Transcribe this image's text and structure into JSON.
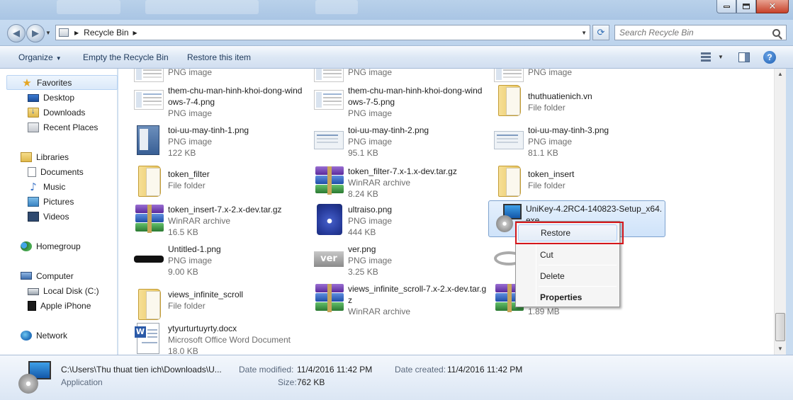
{
  "window": {
    "minimize_glyph": "",
    "close_glyph": "✕"
  },
  "address": {
    "location": "Recycle Bin",
    "search_placeholder": "Search Recycle Bin"
  },
  "toolbar": {
    "organize": "Organize",
    "empty": "Empty the Recycle Bin",
    "restore": "Restore this item",
    "help": "?"
  },
  "nav": {
    "favorites": "Favorites",
    "desktop": "Desktop",
    "downloads": "Downloads",
    "recent": "Recent Places",
    "libraries": "Libraries",
    "documents": "Documents",
    "music": "Music",
    "pictures": "Pictures",
    "videos": "Videos",
    "homegroup": "Homegroup",
    "computer": "Computer",
    "localdisk": "Local Disk (C:)",
    "iphone": "Apple iPhone",
    "network": "Network"
  },
  "files": {
    "row0": [
      {
        "type": "PNG image"
      },
      {
        "type": "PNG image"
      },
      {
        "type": "PNG image"
      }
    ],
    "f1": {
      "name": "them-chu-man-hinh-khoi-dong-windows-7-4.png",
      "type": "PNG image"
    },
    "f2": {
      "name": "them-chu-man-hinh-khoi-dong-windows-7-5.png",
      "type": "PNG image"
    },
    "f3": {
      "name": "thuthuatienich.vn",
      "type": "File folder"
    },
    "f4": {
      "name": "toi-uu-may-tinh-1.png",
      "type": "PNG image",
      "size": "122 KB"
    },
    "f5": {
      "name": "toi-uu-may-tinh-2.png",
      "type": "PNG image",
      "size": "95.1 KB"
    },
    "f6": {
      "name": "toi-uu-may-tinh-3.png",
      "type": "PNG image",
      "size": "81.1 KB"
    },
    "f7": {
      "name": "token_filter",
      "type": "File folder"
    },
    "f8": {
      "name": "token_filter-7.x-1.x-dev.tar.gz",
      "type": "WinRAR archive",
      "size": "8.24 KB"
    },
    "f9": {
      "name": "token_insert",
      "type": "File folder"
    },
    "f10": {
      "name": "token_insert-7.x-2.x-dev.tar.gz",
      "type": "WinRAR archive",
      "size": "16.5 KB"
    },
    "f11": {
      "name": "ultraiso.png",
      "type": "PNG image",
      "size": "444 KB"
    },
    "f12": {
      "name": "UniKey-4.2RC4-140823-Setup_x64.exe"
    },
    "f13": {
      "name": "Untitled-1.png",
      "type": "PNG image",
      "size": "9.00 KB"
    },
    "f14": {
      "name": "ver.png",
      "type": "PNG image",
      "size": "3.25 KB"
    },
    "f16": {
      "name": "views_infinite_scroll",
      "type": "File folder"
    },
    "f17": {
      "name": "views_infinite_scroll-7.x-2.x-dev.tar.gz",
      "type": "WinRAR archive"
    },
    "f18": {
      "size": "1.89 MB"
    },
    "f19": {
      "name": "ytyurturtuyrty.docx",
      "type": "Microsoft Office Word Document",
      "size": "18.0 KB"
    }
  },
  "context_menu": {
    "restore": "Restore",
    "cut": "Cut",
    "delete": "Delete",
    "properties": "Properties"
  },
  "details": {
    "path": "C:\\Users\\Thu thuat tien ich\\Downloads\\U...",
    "kind": "Application",
    "modified_label": "Date modified:",
    "modified_value": "11/4/2016 11:42 PM",
    "created_label": "Date created:",
    "created_value": "11/4/2016 11:42 PM",
    "size_label": "Size:",
    "size_value": "762 KB"
  }
}
